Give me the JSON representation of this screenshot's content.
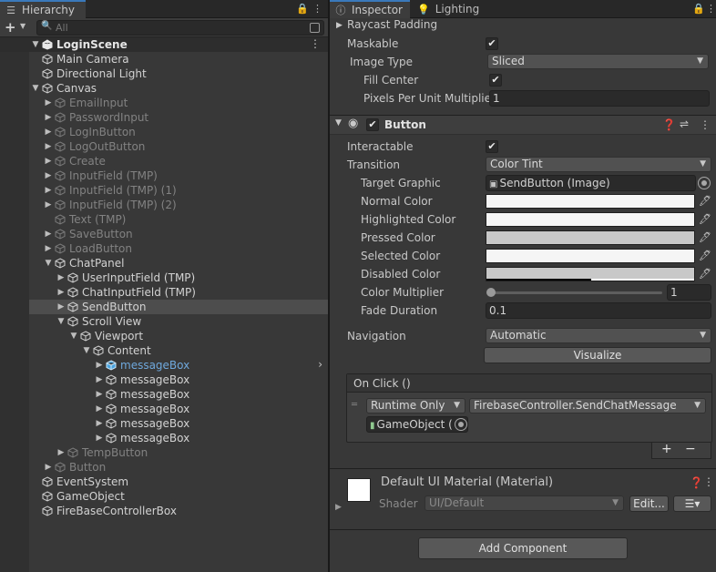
{
  "hierarchy": {
    "tab_label": "Hierarchy",
    "search_placeholder": "All",
    "scene": "LoginScene",
    "items": [
      {
        "label": "Main Camera"
      },
      {
        "label": "Directional Light"
      },
      {
        "label": "Canvas"
      },
      {
        "label": "EmailInput"
      },
      {
        "label": "PasswordInput"
      },
      {
        "label": "LogInButton"
      },
      {
        "label": "LogOutButton"
      },
      {
        "label": "Create"
      },
      {
        "label": "InputField (TMP)"
      },
      {
        "label": "InputField (TMP) (1)"
      },
      {
        "label": "InputField (TMP) (2)"
      },
      {
        "label": "Text (TMP)"
      },
      {
        "label": "SaveButton"
      },
      {
        "label": "LoadButton"
      },
      {
        "label": "ChatPanel"
      },
      {
        "label": "UserInputField (TMP)"
      },
      {
        "label": "ChatInputField (TMP)"
      },
      {
        "label": "SendButton"
      },
      {
        "label": "Scroll View"
      },
      {
        "label": "Viewport"
      },
      {
        "label": "Content"
      },
      {
        "label": "messageBox"
      },
      {
        "label": "messageBox"
      },
      {
        "label": "messageBox"
      },
      {
        "label": "messageBox"
      },
      {
        "label": "messageBox"
      },
      {
        "label": "messageBox"
      },
      {
        "label": "TempButton"
      },
      {
        "label": "Button"
      },
      {
        "label": "EventSystem"
      },
      {
        "label": "GameObject"
      },
      {
        "label": "FireBaseControllerBox"
      }
    ]
  },
  "inspector": {
    "tab_label": "Inspector",
    "lighting_tab": "Lighting",
    "raycast_padding": "Raycast Padding",
    "maskable": "Maskable",
    "image_type_label": "Image Type",
    "image_type_value": "Sliced",
    "fill_center": "Fill Center",
    "ppu_label": "Pixels Per Unit Multiplier",
    "ppu_value": "1",
    "button_component": "Button",
    "interactable": "Interactable",
    "transition_label": "Transition",
    "transition_value": "Color Tint",
    "target_graphic_label": "Target Graphic",
    "target_graphic_value": "SendButton (Image)",
    "normal_color": "Normal Color",
    "highlighted_color": "Highlighted Color",
    "pressed_color": "Pressed Color",
    "selected_color": "Selected Color",
    "disabled_color": "Disabled Color",
    "color_multiplier_label": "Color Multiplier",
    "color_multiplier_value": "1",
    "fade_duration_label": "Fade Duration",
    "fade_duration_value": "0.1",
    "navigation_label": "Navigation",
    "navigation_value": "Automatic",
    "visualize": "Visualize",
    "onclick_label": "On Click ()",
    "runtime_value": "Runtime Only",
    "function_value": "FirebaseController.SendChatMessage",
    "object_value": "GameObject (",
    "plus": "+",
    "minus": "−",
    "material_name": "Default UI Material (Material)",
    "shader_label": "Shader",
    "shader_value": "UI/Default",
    "edit_button": "Edit...",
    "add_component": "Add Component"
  },
  "colors": {
    "normal": "#f5f5f5",
    "highlighted": "#f5f5f5",
    "pressed": "#c8c8c8",
    "selected": "#f5f5f5",
    "disabled": "#c8c8c8",
    "accent": "#3a79bb",
    "selection_text": "#6fa8dc"
  }
}
